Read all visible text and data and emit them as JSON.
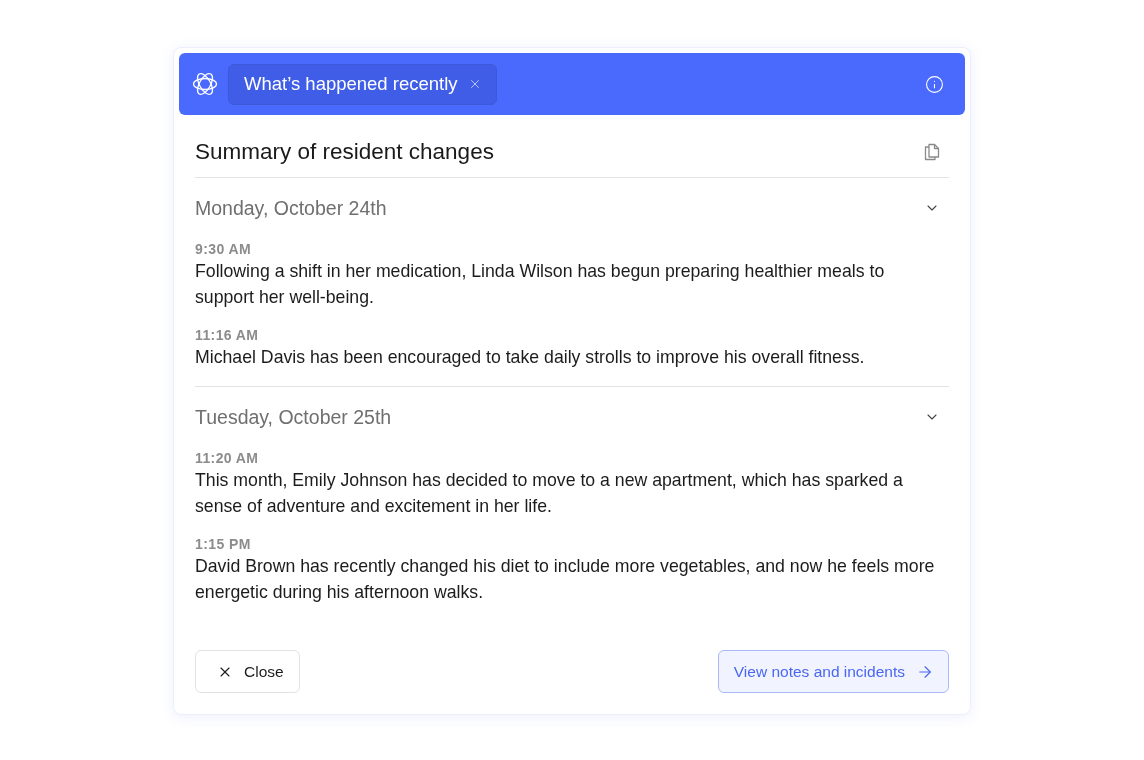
{
  "header": {
    "title": "What’s happened recently"
  },
  "panel": {
    "title": "Summary of resident changes"
  },
  "days": [
    {
      "date": "Monday, October 24th",
      "expanded": true,
      "entries": [
        {
          "time": "9:30 AM",
          "text": "Following a shift in her medication, Linda Wilson has begun preparing healthier meals to support her well-being."
        },
        {
          "time": "11:16 AM",
          "text": "Michael Davis has been encouraged to take daily strolls to improve his overall fitness."
        }
      ]
    },
    {
      "date": "Tuesday, October 25th",
      "expanded": true,
      "entries": [
        {
          "time": "11:20 AM",
          "text": "This month, Emily Johnson has decided to move to a new apartment, which has sparked a sense of adventure and excitement in her life."
        },
        {
          "time": "1:15 PM",
          "text": "David Brown has recently changed his diet to include more vegetables, and now he feels more energetic during his afternoon walks."
        }
      ]
    }
  ],
  "footer": {
    "buttons": [
      {
        "kind": "secondary",
        "label": "Close"
      },
      {
        "kind": "primary",
        "label": "View notes and incidents"
      }
    ]
  }
}
